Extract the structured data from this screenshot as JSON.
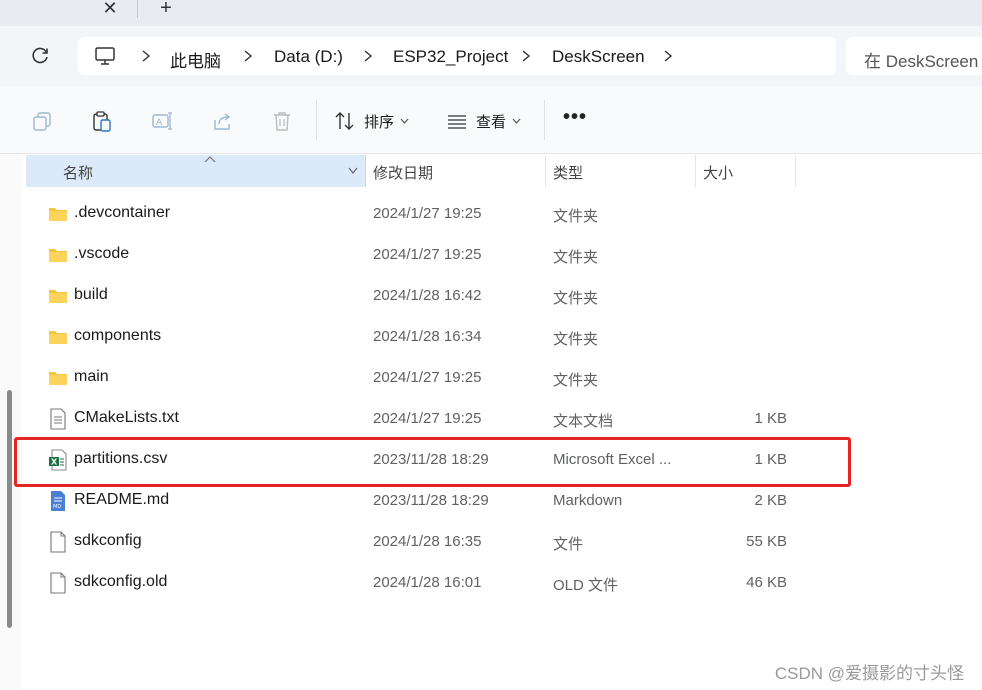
{
  "tabs": {
    "close_glyph": "✕",
    "new_glyph": "+"
  },
  "breadcrumb": [
    "此电脑",
    "Data (D:)",
    "ESP32_Project",
    "DeskScreen"
  ],
  "search": {
    "placeholder": "在 DeskScreen"
  },
  "toolbar": {
    "sort_label": "排序",
    "view_label": "查看",
    "more_label": "•••",
    "icons": [
      "copy-icon",
      "paste-icon",
      "rename-icon",
      "share-icon",
      "delete-icon"
    ]
  },
  "columns": {
    "name": "名称",
    "date": "修改日期",
    "type": "类型",
    "size": "大小"
  },
  "files": [
    {
      "name": ".devcontainer",
      "date": "2024/1/27 19:25",
      "type": "文件夹",
      "size": "",
      "icon": "folder-icon"
    },
    {
      "name": ".vscode",
      "date": "2024/1/27 19:25",
      "type": "文件夹",
      "size": "",
      "icon": "folder-icon"
    },
    {
      "name": "build",
      "date": "2024/1/28 16:42",
      "type": "文件夹",
      "size": "",
      "icon": "folder-icon"
    },
    {
      "name": "components",
      "date": "2024/1/28 16:34",
      "type": "文件夹",
      "size": "",
      "icon": "folder-icon"
    },
    {
      "name": "main",
      "date": "2024/1/27 19:25",
      "type": "文件夹",
      "size": "",
      "icon": "folder-icon"
    },
    {
      "name": "CMakeLists.txt",
      "date": "2024/1/27 19:25",
      "type": "文本文档",
      "size": "1 KB",
      "icon": "text-file-icon"
    },
    {
      "name": "partitions.csv",
      "date": "2023/11/28 18:29",
      "type": "Microsoft Excel ...",
      "size": "1 KB",
      "icon": "excel-file-icon"
    },
    {
      "name": "README.md",
      "date": "2023/11/28 18:29",
      "type": "Markdown",
      "size": "2 KB",
      "icon": "markdown-file-icon"
    },
    {
      "name": "sdkconfig",
      "date": "2024/1/28 16:35",
      "type": "文件",
      "size": "55 KB",
      "icon": "file-icon"
    },
    {
      "name": "sdkconfig.old",
      "date": "2024/1/28 16:01",
      "type": "OLD 文件",
      "size": "46 KB",
      "icon": "file-icon"
    }
  ],
  "highlight_color": "#e52424",
  "watermark": "CSDN @爱摄影的寸头怪"
}
